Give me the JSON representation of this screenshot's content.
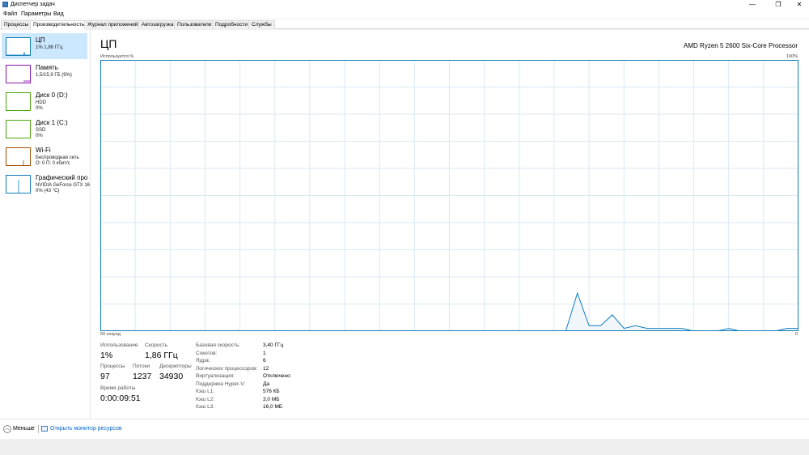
{
  "window": {
    "title": "Диспетчер задач",
    "minimize": "—",
    "maximize": "❐",
    "close": "✕"
  },
  "menu": [
    "Файл",
    "Параметры",
    "Вид"
  ],
  "tabs": [
    "Процессы",
    "Производительность",
    "Журнал приложений",
    "Автозагрузка",
    "Пользователи",
    "Подробности",
    "Службы"
  ],
  "sidebar": [
    {
      "title": "ЦП",
      "lines": [
        "1% 1,86 ГГц"
      ],
      "color": "#117dbb"
    },
    {
      "title": "Память",
      "lines": [
        "1,5/15,9 ГБ (9%)"
      ],
      "color": "#8b12ae"
    },
    {
      "title": "Диск 0 (D:)",
      "lines": [
        "HDD",
        "0%"
      ],
      "color": "#4da60c"
    },
    {
      "title": "Диск 1 (C:)",
      "lines": [
        "SSD",
        "0%"
      ],
      "color": "#4da60c"
    },
    {
      "title": "Wi-Fi",
      "lines": [
        "Беспроводная сеть",
        "О: 0 П: 0 кбит/с"
      ],
      "color": "#a74f01"
    },
    {
      "title": "Графический про",
      "lines": [
        "NVIDIA GeForce GTX 16",
        "0% (43 °C)"
      ],
      "color": "#117dbb"
    }
  ],
  "main": {
    "title": "ЦП",
    "cpu_model": "AMD Ryzen 5 2600 Six-Core Processor",
    "util_label": "Используется %",
    "max_label": "100%",
    "time_label": "60 секунд",
    "zero_label": "0"
  },
  "chart_data": {
    "type": "area",
    "x": [
      0,
      2,
      4,
      6,
      8,
      10,
      12,
      14,
      16,
      18,
      20,
      22,
      24,
      26,
      28,
      30,
      32,
      34,
      36,
      38,
      39,
      40,
      41,
      42,
      43,
      44,
      45,
      46,
      47,
      48,
      49,
      50,
      51,
      52,
      53,
      54,
      55,
      56,
      57,
      58,
      59,
      60
    ],
    "values": [
      0,
      0,
      0,
      0,
      0,
      0,
      0,
      0,
      0,
      0,
      0,
      0,
      0,
      0,
      0,
      0,
      0,
      0,
      0,
      0,
      0,
      0,
      14,
      2,
      2,
      6,
      1,
      2,
      1,
      1,
      1,
      1,
      0,
      0,
      0,
      1,
      0,
      0,
      0,
      0,
      1,
      1
    ],
    "xlim": [
      0,
      60
    ],
    "ylim": [
      0,
      100
    ],
    "xlabel": "60 секунд",
    "ylabel": "Используется %",
    "grid": true,
    "line_color": "#117dbb",
    "fill_color": "#f1f6fa",
    "grid_color": "#d9eaf4"
  },
  "stats": {
    "usage_label": "Использование",
    "usage_value": "1%",
    "speed_label": "Скорость",
    "speed_value": "1,86 ГГц",
    "processes_label": "Процессы",
    "processes_value": "97",
    "threads_label": "Потоки",
    "threads_value": "1237",
    "handles_label": "Дескрипторы",
    "handles_value": "34930",
    "uptime_label": "Время работы",
    "uptime_value": "0:00:09:51"
  },
  "specs": [
    {
      "k": "Базовая скорость:",
      "v": "3,40 ГГц"
    },
    {
      "k": "Сокетов:",
      "v": "1"
    },
    {
      "k": "Ядра:",
      "v": "6"
    },
    {
      "k": "Логических процессоров:",
      "v": "12"
    },
    {
      "k": "Виртуализация:",
      "v": "Отключено"
    },
    {
      "k": "Поддержка Hyper-V:",
      "v": "Да"
    },
    {
      "k": "Кэш L1:",
      "v": "576 КБ"
    },
    {
      "k": "Кэш L2:",
      "v": "3,0 МБ"
    },
    {
      "k": "Кэш L3:",
      "v": "16,0 МБ"
    }
  ],
  "footer": {
    "less_label": "Меньше",
    "less_icon": "chevron-up-icon",
    "monitor_label": "Открыть монитор ресурсов",
    "monitor_icon": "resource-monitor-icon"
  }
}
